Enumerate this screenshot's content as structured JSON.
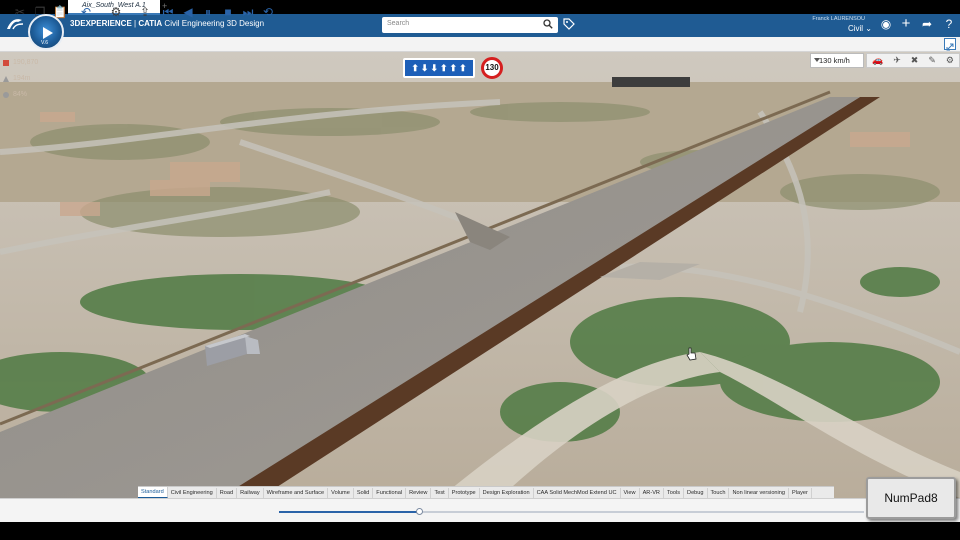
{
  "header": {
    "brand": "3DEXPERIENCE",
    "product": "CATIA",
    "app_name": "Civil Engineering 3D Design",
    "search_placeholder": "Search",
    "user_name": "Franck LAURENSOU",
    "role": "Civil",
    "compass_version": "V.6"
  },
  "tabs": [
    {
      "label": "Aix_South_West A.1"
    }
  ],
  "viewport": {
    "stats": [
      {
        "label": "190,870",
        "color": "#d24b3c"
      },
      {
        "label": "194m",
        "color": "#9a9a9a"
      },
      {
        "label": "84%",
        "color": "#9a9a9a"
      }
    ],
    "lane_arrows": [
      "⬆",
      "⬇",
      "⬇",
      "⬆",
      "⬆",
      "⬆"
    ],
    "speed_limit": "130",
    "speed_value": "130 km/h"
  },
  "action_bar": {
    "tabs": [
      "Standard",
      "Civil Engineering",
      "Road",
      "Railway",
      "Wireframe and Surface",
      "Volume",
      "Solid",
      "Functional",
      "Review",
      "Test",
      "Prototype",
      "Design Exploration",
      "CAA Solid MechMod Extend UC",
      "View",
      "AR-VR",
      "Tools",
      "Debug",
      "Touch",
      "Non linear versioning",
      "Player"
    ],
    "active_tab": "Standard"
  },
  "player": {
    "progress": 0.24
  },
  "key_badge": "NumPad8"
}
